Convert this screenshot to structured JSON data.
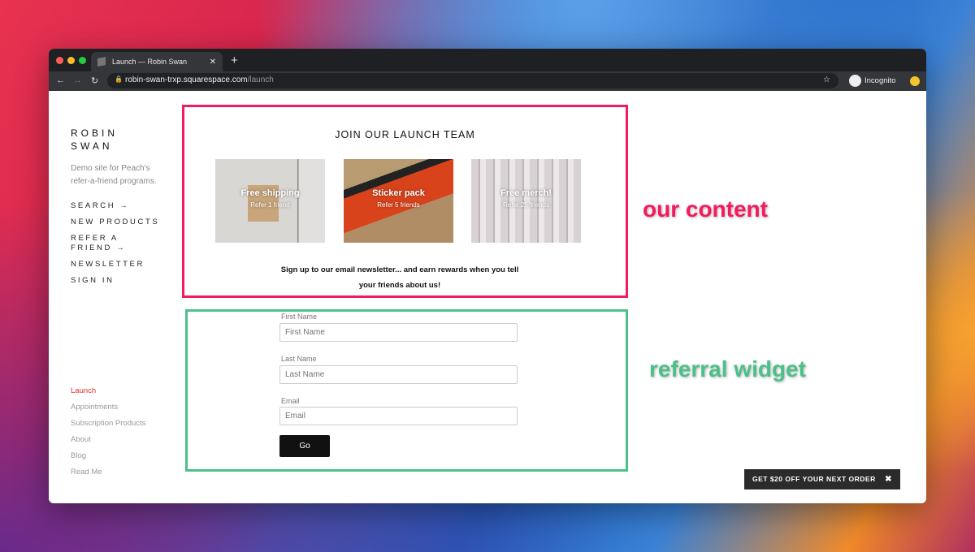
{
  "browser": {
    "tab_title": "Launch — Robin Swan",
    "url_host": "robin-swan-trxp.squarespace.com",
    "url_path": "/launch",
    "profile": "Incognito"
  },
  "sidebar": {
    "brand_line1": "ROBIN",
    "brand_line2": "SWAN",
    "tagline": "Demo site for Peach's refer-a-friend programs.",
    "nav": [
      "SEARCH →",
      "NEW PRODUCTS",
      "REFER A FRIEND →",
      "NEWSLETTER",
      "SIGN IN"
    ],
    "pages": [
      "Launch",
      "Appointments",
      "Subscription Products",
      "About",
      "Blog",
      "Read Me"
    ]
  },
  "content": {
    "heading": "JOIN OUR LAUNCH TEAM",
    "rewards": [
      {
        "title": "Free shipping",
        "subtitle": "Refer 1 friend"
      },
      {
        "title": "Sticker pack",
        "subtitle": "Refer 5 friends"
      },
      {
        "title": "Free merch!",
        "subtitle": "Refer 25 friends"
      }
    ],
    "description": "Sign up to our email newsletter... and earn rewards when you tell your friends about us!"
  },
  "form": {
    "first_name_label": "First Name",
    "first_name_placeholder": "First Name",
    "last_name_label": "Last Name",
    "last_name_placeholder": "Last Name",
    "email_label": "Email",
    "email_placeholder": "Email",
    "submit": "Go"
  },
  "annotations": {
    "content": "our content",
    "widget": "referral widget",
    "content_color": "#f31a5e",
    "widget_color": "#4dc08a"
  },
  "promo": {
    "text": "GET $20 OFF YOUR NEXT ORDER",
    "close": "✖"
  }
}
